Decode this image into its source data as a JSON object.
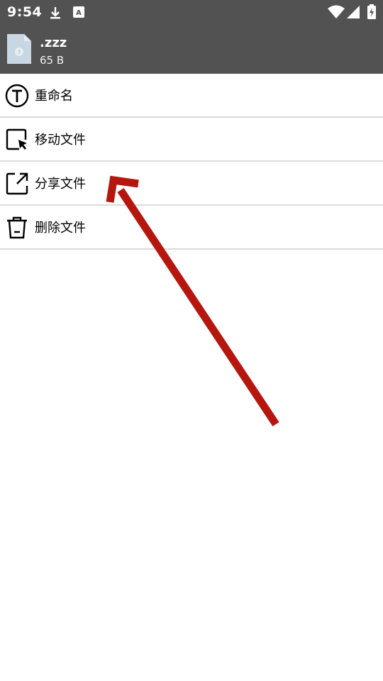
{
  "status_bar": {
    "time": "9:54",
    "icons": [
      "download-icon",
      "app-notification-icon",
      "wifi-icon",
      "signal-icon",
      "battery-charging-icon"
    ]
  },
  "header": {
    "file_name": ".zzz",
    "file_size": "65 B",
    "thumb_icon": "unknown-file-icon"
  },
  "menu": {
    "items": [
      {
        "label": "重命名",
        "icon": "rename-icon"
      },
      {
        "label": "移动文件",
        "icon": "move-file-icon"
      },
      {
        "label": "分享文件",
        "icon": "share-icon"
      },
      {
        "label": "删除文件",
        "icon": "delete-icon"
      }
    ]
  },
  "annotation": {
    "color": "#b5170f",
    "icon": "arrow-annotation"
  },
  "colors": {
    "header_bg": "#525252",
    "divider": "#dcdcdc",
    "thumb": "#c9d6e3"
  }
}
